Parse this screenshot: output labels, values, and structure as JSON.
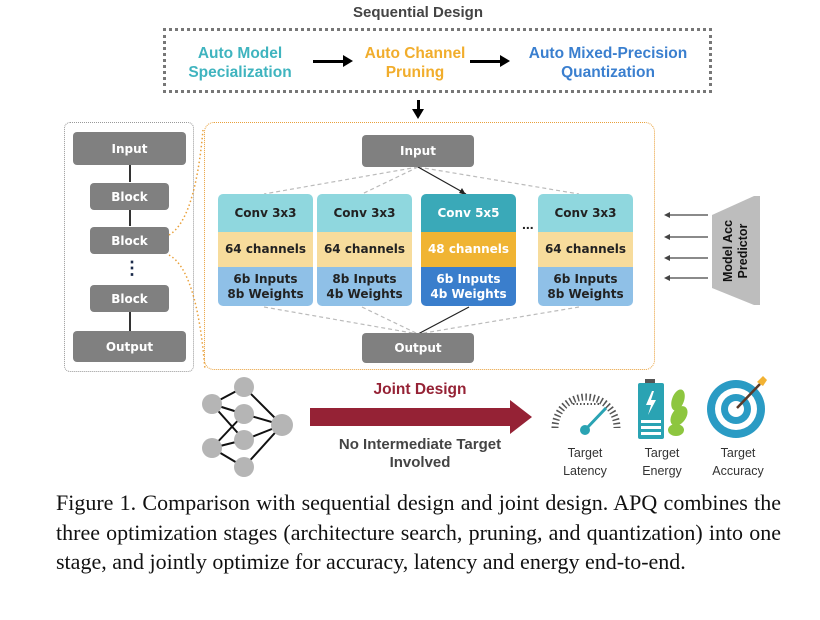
{
  "sequential": {
    "title": "Sequential Design",
    "stages": [
      {
        "line1": "Auto Model",
        "line2": "Specialization",
        "color": "#3fb4bf"
      },
      {
        "line1": "Auto Channel",
        "line2": "Pruning",
        "color": "#f1ad2c"
      },
      {
        "line1": "Auto Mixed-Precision",
        "line2": "Quantization",
        "color": "#3a7fcf"
      }
    ]
  },
  "network": {
    "input": "Input",
    "blocks": [
      "Block",
      "Block",
      "Block"
    ],
    "ellipsis": "⋮",
    "output": "Output"
  },
  "block_detail": {
    "input": "Input",
    "output": "Output",
    "ellipsis": "...",
    "columns": [
      {
        "conv": "Conv 3x3",
        "channels": "64 channels",
        "quant1": "6b Inputs",
        "quant2": "8b Weights",
        "selected": false
      },
      {
        "conv": "Conv 3x3",
        "channels": "64 channels",
        "quant1": "8b Inputs",
        "quant2": "4b Weights",
        "selected": false
      },
      {
        "conv": "Conv 5x5",
        "channels": "48 channels",
        "quant1": "6b Inputs",
        "quant2": "4b Weights",
        "selected": true
      },
      {
        "conv": "Conv 3x3",
        "channels": "64 channels",
        "quant1": "6b Inputs",
        "quant2": "8b Weights",
        "selected": false
      }
    ]
  },
  "predictor": {
    "line1": "Model Acc",
    "line2": "Predictor"
  },
  "joint": {
    "title": "Joint Design",
    "subtitle_line1": "No Intermediate Target",
    "subtitle_line2": "Involved",
    "arrow_color": "#952235"
  },
  "targets": [
    {
      "icon": "speedometer-icon",
      "line1": "Target",
      "line2": "Latency"
    },
    {
      "icon": "battery-leaf-icon",
      "line1": "Target",
      "line2": "Energy"
    },
    {
      "icon": "target-icon",
      "line1": "Target",
      "line2": "Accuracy"
    }
  ],
  "caption": "Figure 1. Comparison with sequential design and joint design. APQ combines the three optimization stages (architecture search, pruning, and quantization) into one stage, and jointly optimize for accuracy, latency and energy end-to-end."
}
